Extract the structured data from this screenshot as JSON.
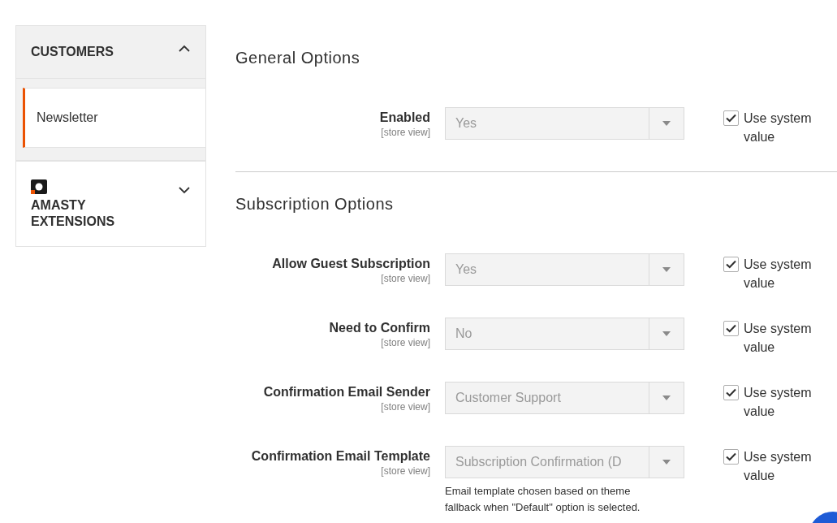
{
  "sidebar": {
    "sections": [
      {
        "title": "CUSTOMERS",
        "logo": false,
        "expanded": true,
        "items": [
          {
            "label": "Newsletter",
            "selected": true
          }
        ]
      },
      {
        "title": "AMASTY EXTENSIONS",
        "logo": true,
        "expanded": false
      }
    ]
  },
  "groups": [
    {
      "title": "General Options",
      "fields": [
        {
          "label": "Enabled",
          "scope": "[store view]",
          "value": "Yes",
          "disabled": true,
          "use_system_value": {
            "label": "Use system value",
            "checked": true
          }
        }
      ]
    },
    {
      "title": "Subscription Options",
      "fields": [
        {
          "label": "Allow Guest Subscription",
          "scope": "[store view]",
          "value": "Yes",
          "disabled": true,
          "use_system_value": {
            "label": "Use system value",
            "checked": true
          }
        },
        {
          "label": "Need to Confirm",
          "scope": "[store view]",
          "value": "No",
          "disabled": true,
          "use_system_value": {
            "label": "Use system value",
            "checked": true
          }
        },
        {
          "label": "Confirmation Email Sender",
          "scope": "[store view]",
          "value": "Customer Support",
          "disabled": true,
          "use_system_value": {
            "label": "Use system value",
            "checked": true
          }
        },
        {
          "label": "Confirmation Email Template",
          "scope": "[store view]",
          "value": "Subscription Confirmation (D",
          "disabled": true,
          "note": "Email template chosen based on theme fallback when \"Default\" option is selected.",
          "use_system_value": {
            "label": "Use system value",
            "checked": true
          }
        }
      ]
    }
  ]
}
